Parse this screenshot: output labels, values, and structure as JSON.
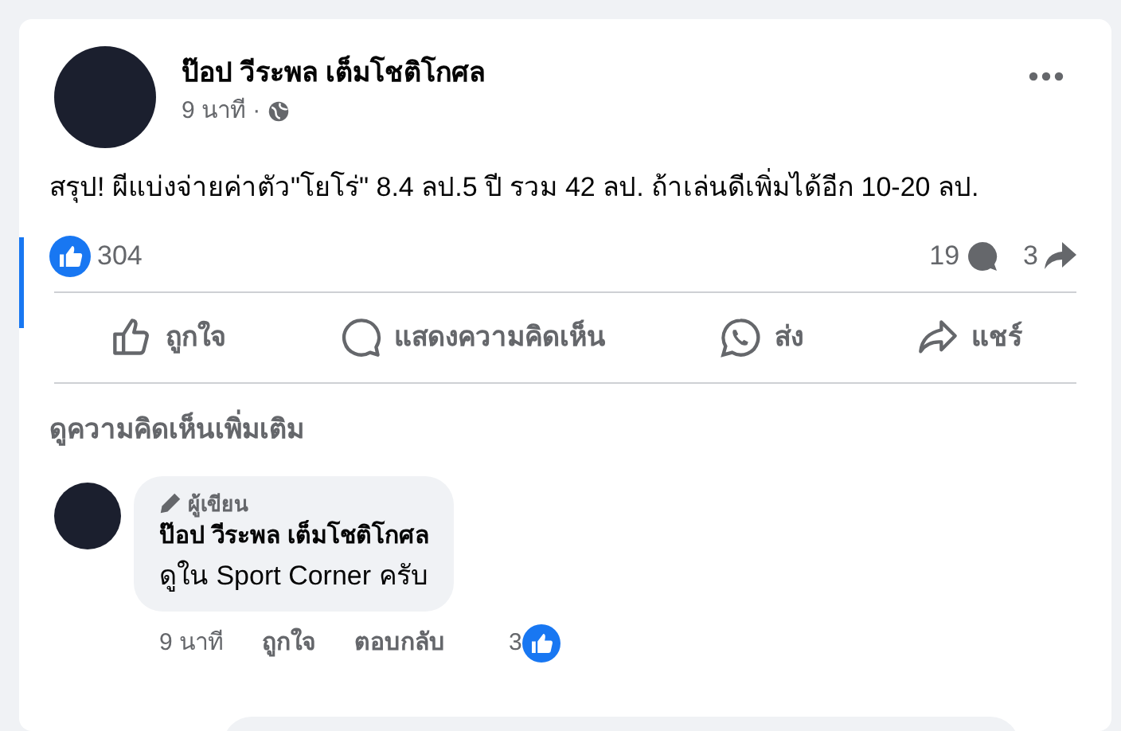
{
  "post": {
    "author": "ป๊อป วีระพล เต็มโชติโกศล",
    "time": "9 นาที ·",
    "text": "สรุป! ผีแบ่งจ่ายค่าตัว\"โยโร่\" 8.4 ลป.5 ปี รวม 42 ลป. ถ้าเล่นดีเพิ่มได้อีก 10-20 ลป.",
    "reactions": "304",
    "comments": "19",
    "shares": "3"
  },
  "actions": [
    {
      "kind": "like",
      "label": "ถูกใจ"
    },
    {
      "kind": "comment",
      "label": "แสดงความคิดเห็น"
    },
    {
      "kind": "send",
      "label": "ส่ง"
    },
    {
      "kind": "share",
      "label": "แชร์"
    }
  ],
  "more_comments": "ดูความคิดเห็นเพิ่มเติม",
  "comments": [
    {
      "badge": "ผู้เขียน",
      "author": "ป๊อป วีระพล เต็มโชติโกศล",
      "text": "ดูใน Sport Corner ครับ",
      "time": "9 นาที",
      "like": "ถูกใจ",
      "reply": "ตอบกลับ",
      "reactions": "3"
    }
  ]
}
